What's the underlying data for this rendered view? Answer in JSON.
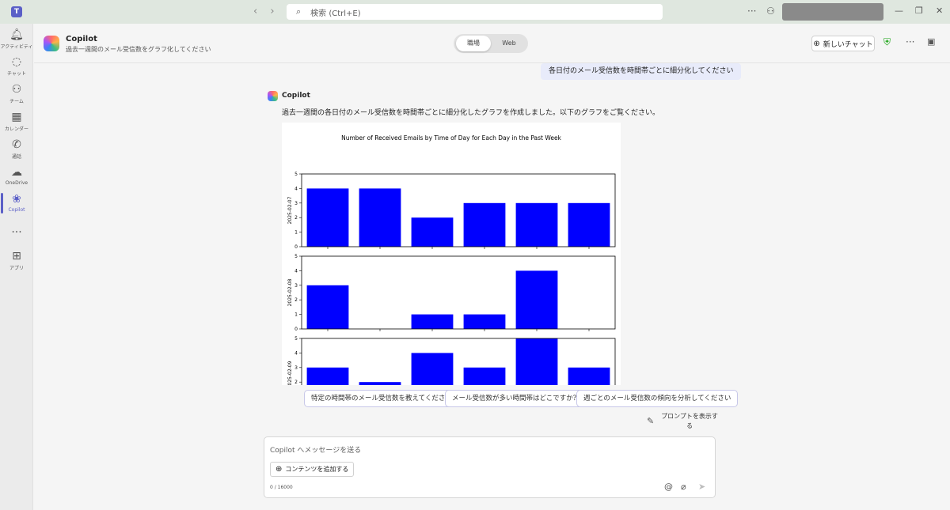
{
  "titlebar": {
    "search_placeholder": "検索 (Ctrl+E)",
    "back_icon": "‹",
    "forward_icon": "›"
  },
  "rail": {
    "items": [
      {
        "label": "アクティビティ",
        "icon": "bell-icon"
      },
      {
        "label": "チャット",
        "icon": "chat-icon"
      },
      {
        "label": "チーム",
        "icon": "teams-icon"
      },
      {
        "label": "カレンダー",
        "icon": "calendar-icon"
      },
      {
        "label": "通話",
        "icon": "phone-icon"
      },
      {
        "label": "OneDrive",
        "icon": "cloud-icon"
      },
      {
        "label": "Copilot",
        "icon": "copilot-icon"
      },
      {
        "label": "",
        "icon": "more-icon"
      },
      {
        "label": "アプリ",
        "icon": "apps-icon"
      }
    ]
  },
  "header": {
    "title": "Copilot",
    "subtitle": "過去一週間のメール受信数をグラフ化してください",
    "toggle_work": "職場",
    "toggle_web": "Web",
    "new_chat": "新しいチャット"
  },
  "conversation": {
    "user_message": "各日付のメール受信数を時間帯ごとに細分化してください",
    "assistant_name": "Copilot",
    "assistant_text": "過去一週間の各日付のメール受信数を時間帯ごとに細分化したグラフを作成しました。以下のグラフをご覧ください。"
  },
  "chart_data": {
    "type": "bar",
    "title": "Number of Received Emails by Time of Day for Each Day in the Past Week",
    "ylim": [
      0,
      5
    ],
    "yticks": [
      0,
      1,
      2,
      3,
      4,
      5
    ],
    "panels": [
      {
        "ylabel": "2025-02-07",
        "values": [
          4,
          4,
          2,
          3,
          3,
          3
        ]
      },
      {
        "ylabel": "2025-02-08",
        "values": [
          3,
          0,
          1,
          1,
          4,
          0
        ]
      },
      {
        "ylabel": "2025-02-09",
        "values": [
          3,
          2,
          4,
          3,
          5,
          3
        ]
      }
    ],
    "bar_color": "#0000ff"
  },
  "suggestions": [
    "特定の時間帯のメール受信数を教えてください",
    "メール受信数が多い時間帯はどこですか？",
    "週ごとのメール受信数の傾向を分析してください"
  ],
  "prompt_button": "プロンプトを表示する",
  "composer": {
    "placeholder": "Copilot へメッセージを送る",
    "add_content": "コンテンツを追加する",
    "counter": "0 / 16000"
  },
  "colors": {
    "accent": "#5b5fc7",
    "shield": "#13a10e"
  }
}
